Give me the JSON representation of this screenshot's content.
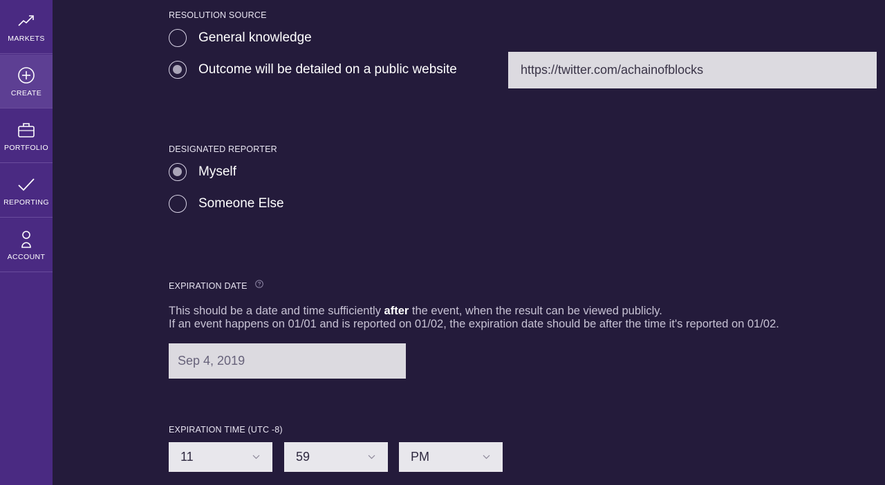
{
  "sidebar": {
    "items": [
      {
        "label": "MARKETS",
        "icon": "trending-up-icon",
        "active": false
      },
      {
        "label": "CREATE",
        "icon": "plus-circle-icon",
        "active": true
      },
      {
        "label": "PORTFOLIO",
        "icon": "briefcase-icon",
        "active": false
      },
      {
        "label": "REPORTING",
        "icon": "checkmark-icon",
        "active": false
      },
      {
        "label": "ACCOUNT",
        "icon": "user-icon",
        "active": false
      }
    ]
  },
  "resolution_source": {
    "heading": "RESOLUTION SOURCE",
    "options": [
      {
        "label": "General knowledge",
        "checked": false
      },
      {
        "label": "Outcome will be detailed on a public website",
        "checked": true
      }
    ],
    "url_value": "https://twitter.com/achainofblocks"
  },
  "designated_reporter": {
    "heading": "DESIGNATED REPORTER",
    "options": [
      {
        "label": "Myself",
        "checked": true
      },
      {
        "label": "Someone Else",
        "checked": false
      }
    ]
  },
  "expiration_date": {
    "heading": "EXPIRATION DATE",
    "help_icon": "question-circle-icon",
    "desc_line1_before": "This should be a date and time sufficiently ",
    "desc_line1_bold": "after",
    "desc_line1_after": " the event, when the result can be viewed publicly.",
    "desc_line2": "If an event happens on 01/01 and is reported on 01/02, the expiration date should be after the time it's reported on 01/02.",
    "value": "Sep 4, 2019"
  },
  "expiration_time": {
    "heading": "EXPIRATION TIME (UTC -8)",
    "hour": "11",
    "minute": "59",
    "meridiem": "PM"
  }
}
